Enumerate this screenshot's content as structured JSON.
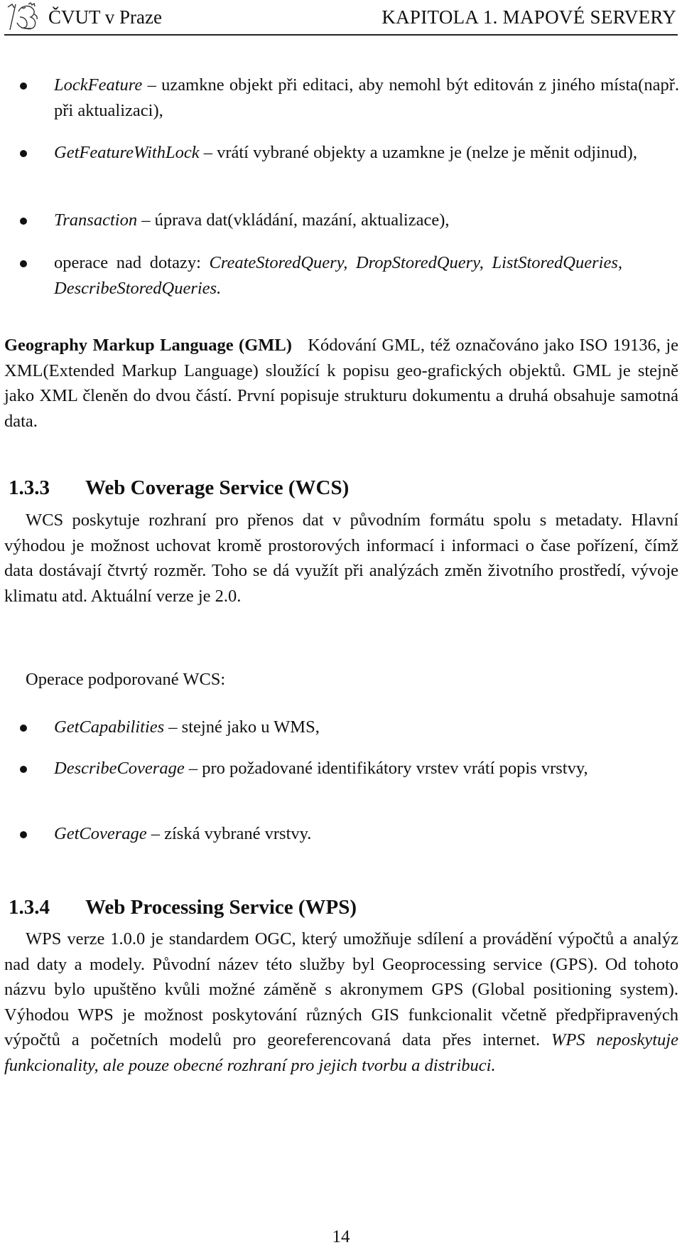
{
  "header": {
    "logo_icon": "cvut-lion-logo-icon",
    "left_title": "ČVUT v Praze",
    "right_title": "KAPITOLA 1.  MAPOVÉ SERVERY"
  },
  "wfs_operations": [
    {
      "term": "LockFeature",
      "text": " – uzamkne objekt při editaci, aby nemohl být editován z jiného místa(např. při aktualizaci),"
    },
    {
      "term": "GetFeatureWithLock",
      "text": " – vrátí vybrané objekty a uzamkne je (nelze je měnit odjinud),"
    },
    {
      "term": "Transaction",
      "text": " – úprava dat(vkládání, mazání, aktualizace),"
    },
    {
      "prefix": "operace nad dotazy: ",
      "term": "CreateStoredQuery, DropStoredQuery, ListStoredQueries, DescribeStoredQueries."
    }
  ],
  "gml": {
    "title": "Geography Markup Language (GML)",
    "text": "Kódování GML, též označováno jako ISO 19136, je XML(Extended Markup Language) sloužící k popisu geo-grafických objektů. GML je stejně jako XML členěn do dvou částí. První popisuje strukturu dokumentu a druhá obsahuje samotná data."
  },
  "section_wcs": {
    "number": "1.3.3",
    "title": "Web Coverage Service (WCS)",
    "paragraph": "WCS poskytuje rozhraní pro přenos dat v původním formátu spolu s metadaty. Hlavní výhodou je možnost uchovat kromě prostorových informací i informaci o čase pořízení, čímž data dostávají čtvrtý rozměr. Toho se dá využít při analýzách změn životního prostředí, vývoje klimatu atd. Aktuální verze je 2.0.",
    "operations_intro": "Operace podporované WCS:",
    "operations": [
      {
        "term": "GetCapabilities",
        "text": " – stejné jako u WMS,"
      },
      {
        "term": "DescribeCoverage",
        "text": " – pro požadované identifikátory vrstev vrátí popis vrstvy,"
      },
      {
        "term": "GetCoverage",
        "text": " – získá vybrané vrstvy."
      }
    ]
  },
  "section_wps": {
    "number": "1.3.4",
    "title": "Web Processing Service (WPS)",
    "paragraph": "WPS verze 1.0.0 je standardem OGC, který umožňuje sdílení a provádění výpočtů a analýz nad daty a modely. Původní název této služby byl Geoprocessing service (GPS). Od tohoto názvu bylo upuštěno kvůli možné záměně s akronymem GPS (Global positioning system). Výhodou WPS je možnost poskytování různých GIS funkcionalit včetně předpřipravených výpočtů a početních modelů pro georeferencovaná data přes internet. ",
    "paragraph_italic": "WPS neposkytuje funkcionality, ale pouze obecné rozhraní pro jejich tvorbu a distribuci."
  },
  "page_number": "14"
}
